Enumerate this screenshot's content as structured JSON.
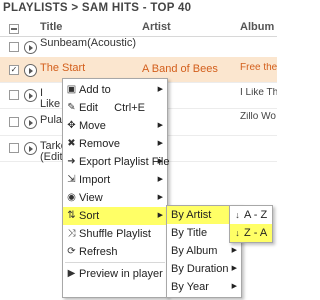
{
  "breadcrumb": "PLAYLISTS > SAM HITS - TOP 40",
  "columns": {
    "title": "Title",
    "artist": "Artist",
    "album": "Album"
  },
  "rows": [
    {
      "title": "Sunbeam(Acoustic)",
      "artist": "",
      "album": "",
      "checked": false,
      "selected": false
    },
    {
      "title": "The Start",
      "artist": "A Band of Bees",
      "album": "Free the",
      "checked": true,
      "selected": true
    },
    {
      "title": "I Like",
      "artist": "",
      "album": "I Like Th here",
      "checked": false,
      "selected": false
    },
    {
      "title": "Pulas",
      "artist": "",
      "album": "Zillo Wo Massive",
      "checked": false,
      "selected": false
    },
    {
      "title": "Tarko (Edit)",
      "artist": "",
      "album": "",
      "checked": false,
      "selected": false
    }
  ],
  "context_menu": {
    "items": [
      {
        "label": "Add to",
        "icon": "add-to-icon",
        "glyph": "▣",
        "submenu": true
      },
      {
        "label": "Edit",
        "icon": "edit-icon",
        "glyph": "✎",
        "shortcut": "Ctrl+E"
      },
      {
        "label": "Move",
        "icon": "move-icon",
        "glyph": "✥",
        "submenu": true
      },
      {
        "label": "Remove",
        "icon": "remove-icon",
        "glyph": "✖",
        "submenu": true
      },
      {
        "label": "Export Playlist File",
        "icon": "export-icon",
        "glyph": "➜",
        "submenu": true
      },
      {
        "label": "Import",
        "icon": "import-icon",
        "glyph": "⇲",
        "submenu": true
      },
      {
        "label": "View",
        "icon": "view-icon",
        "glyph": "◉",
        "submenu": true
      },
      {
        "label": "Sort",
        "icon": "sort-icon",
        "glyph": "⇅",
        "submenu": true,
        "highlighted": true
      },
      {
        "label": "Shuffle Playlist",
        "icon": "shuffle-icon",
        "glyph": "⤨"
      },
      {
        "label": "Refresh",
        "icon": "refresh-icon",
        "glyph": "⟳"
      },
      {
        "label": "Preview in player",
        "icon": "play-icon",
        "glyph": "▶"
      }
    ]
  },
  "sort_menu": {
    "items": [
      {
        "label": "By Artist",
        "highlighted": true
      },
      {
        "label": "By Title"
      },
      {
        "label": "By Album"
      },
      {
        "label": "By Duration"
      },
      {
        "label": "By Year"
      }
    ]
  },
  "sort_artist_menu": {
    "items": [
      {
        "label": "A - Z",
        "icon": "sort-ascending-icon",
        "glyph": "↓"
      },
      {
        "label": "Z - A",
        "icon": "sort-descending-icon",
        "glyph": "↓",
        "highlighted": true
      }
    ]
  },
  "colors": {
    "selected_row_bg": "#fbe6cf",
    "selected_row_text": "#d35f1c",
    "menu_highlight": "#ffff66"
  }
}
